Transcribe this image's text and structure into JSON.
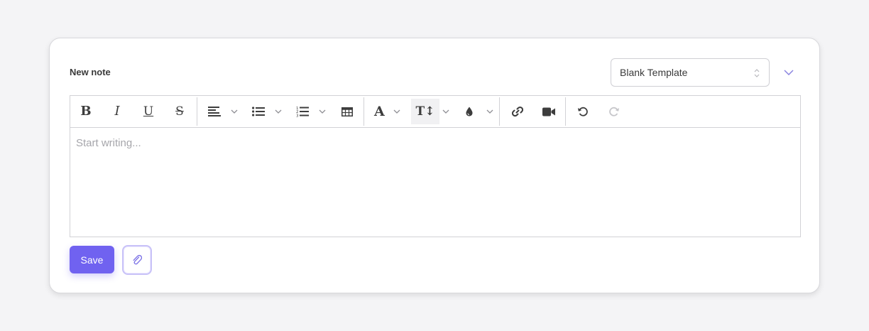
{
  "note": {
    "title": "New note",
    "placeholder": "Start writing..."
  },
  "template_select": {
    "selected": "Blank Template"
  },
  "toolbar": {
    "bold_label": "B",
    "italic_label": "I",
    "underline_label": "U",
    "strike_label": "S",
    "font_label": "A",
    "text_size_label": "T↕"
  },
  "actions": {
    "save_label": "Save"
  },
  "colors": {
    "accent": "#7062f0",
    "accent_light": "#c8c2f8",
    "chevron": "#8a84e0"
  },
  "icons": [
    "bold-icon",
    "italic-icon",
    "underline-icon",
    "strikethrough-icon",
    "align-left-icon",
    "bullet-list-icon",
    "numbered-list-icon",
    "table-icon",
    "font-icon",
    "text-size-icon",
    "color-drop-icon",
    "link-icon",
    "video-icon",
    "undo-icon",
    "redo-icon",
    "paperclip-icon",
    "chevron-down-icon",
    "updown-icon"
  ]
}
